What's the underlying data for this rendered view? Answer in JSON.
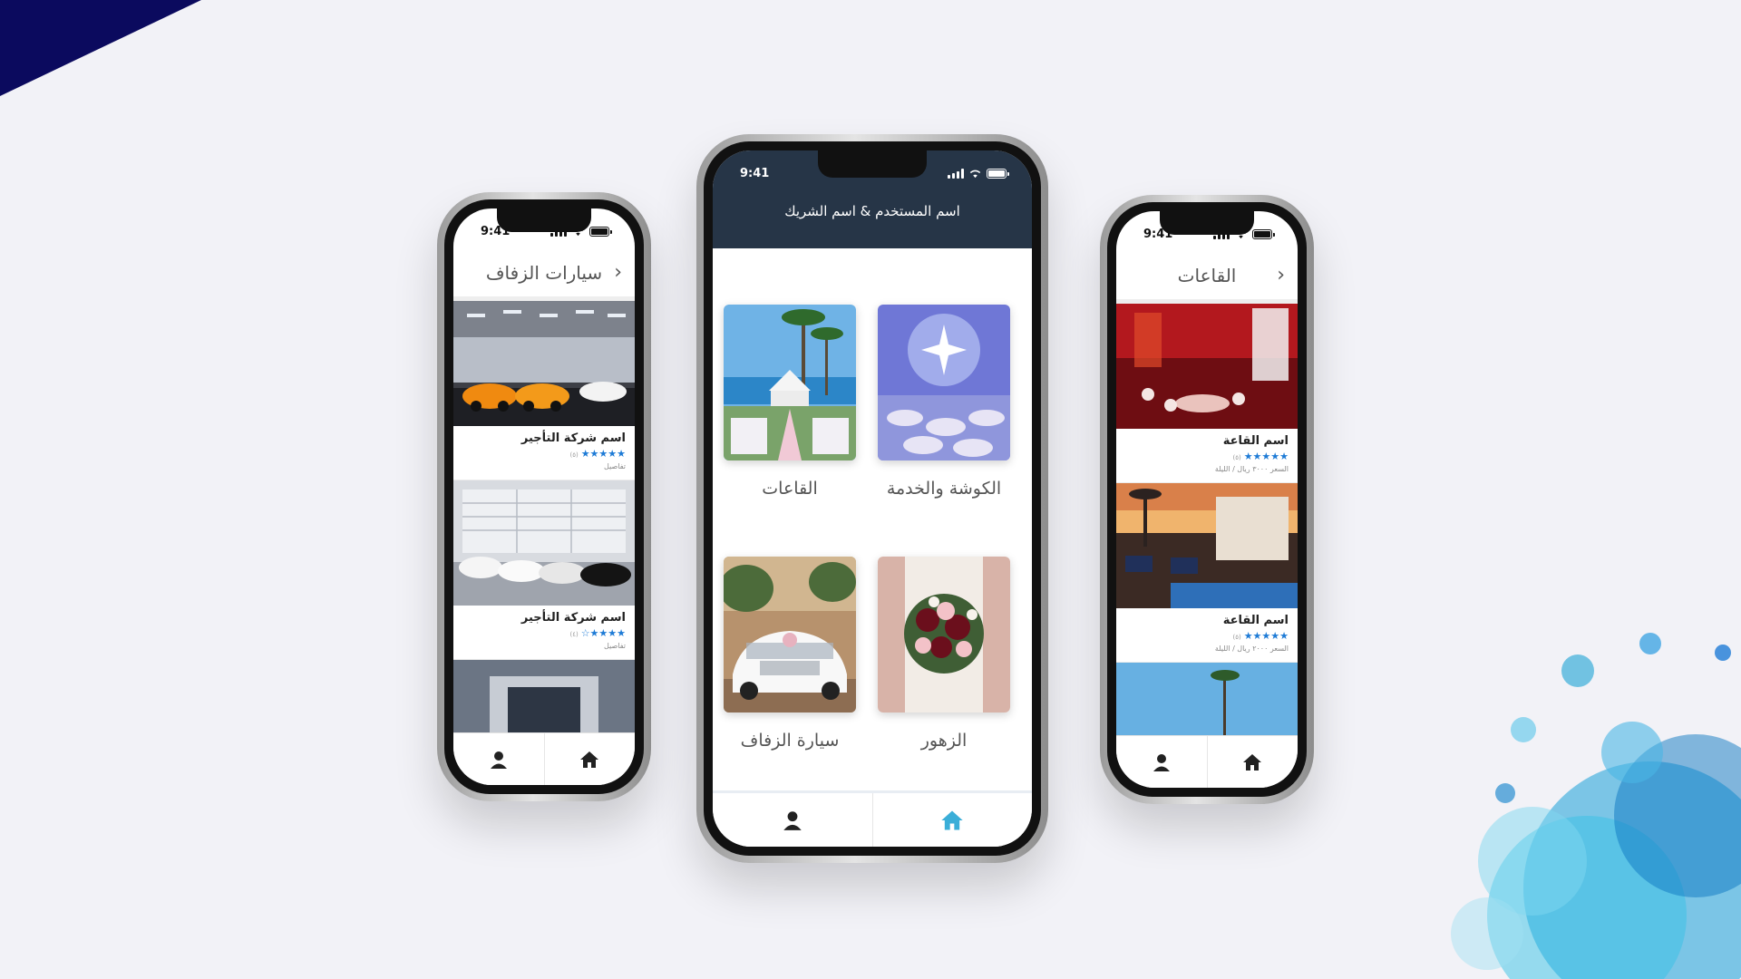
{
  "colors": {
    "background": "#f2f2f7",
    "accent_dark": "#263547",
    "corner": "#0b0a5e",
    "star": "#1e7bd6",
    "tab_active": "#3aaed8",
    "tab_inactive": "#222222"
  },
  "status_time": "9:41",
  "left_phone": {
    "title": "سيارات الزفاف",
    "back_icon": "chevron-right-icon",
    "items": [
      {
        "name": "اسم شركة التأجير",
        "stars": "★★★★★",
        "rating_note": "(٥)",
        "sub": "تفاصيل"
      },
      {
        "name": "اسم شركة التأجير",
        "stars": "★★★★☆",
        "rating_note": "(٤)",
        "sub": "تفاصيل"
      }
    ]
  },
  "center_phone": {
    "header_title": "اسم المستخدم & اسم الشريك",
    "categories": [
      {
        "label": "الكوشة والخدمة",
        "icon": "decor-photo"
      },
      {
        "label": "القاعات",
        "icon": "venue-photo"
      },
      {
        "label": "الزهور",
        "icon": "flowers-photo"
      },
      {
        "label": "سيارة الزفاف",
        "icon": "car-photo"
      }
    ]
  },
  "right_phone": {
    "title": "القاعات",
    "back_icon": "chevron-right-icon",
    "items": [
      {
        "name": "اسم القاعة",
        "stars": "★★★★★",
        "rating_note": "(٥)",
        "sub": "السعر ٣٠٠٠ ريال / الليلة"
      },
      {
        "name": "اسم القاعة",
        "stars": "★★★★★",
        "rating_note": "(٥)",
        "sub": "السعر ٢٠٠٠ ريال / الليلة"
      }
    ]
  },
  "tabbar": {
    "profile_icon": "user-icon",
    "home_icon": "home-icon"
  }
}
